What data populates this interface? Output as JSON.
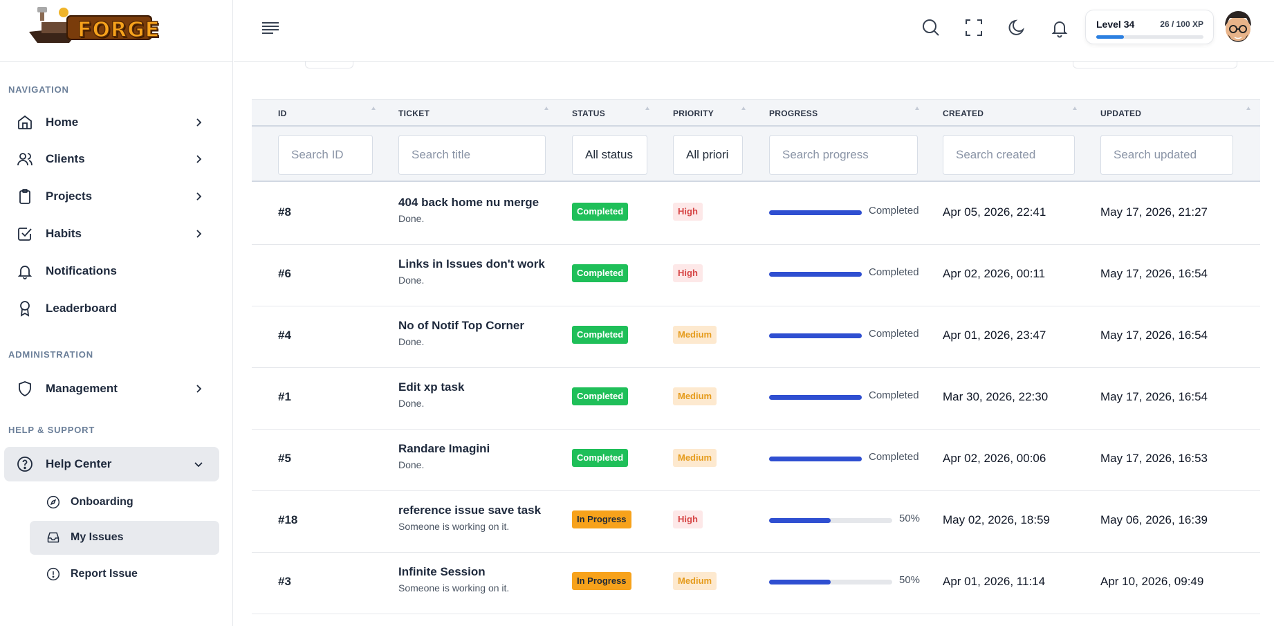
{
  "app": {
    "logo_text": "FORGE"
  },
  "sidebar": {
    "sections": {
      "navigation": "NAVIGATION",
      "administration": "ADMINISTRATION",
      "help": "HELP & SUPPORT"
    },
    "items": [
      {
        "label": "Home",
        "icon": "home-icon"
      },
      {
        "label": "Clients",
        "icon": "users-icon"
      },
      {
        "label": "Projects",
        "icon": "clipboard-icon"
      },
      {
        "label": "Habits",
        "icon": "checkbox-icon"
      },
      {
        "label": "Notifications",
        "icon": "bell-icon"
      },
      {
        "label": "Leaderboard",
        "icon": "award-icon"
      },
      {
        "label": "Management",
        "icon": "shield-icon"
      },
      {
        "label": "Help Center",
        "icon": "help-circle-icon"
      }
    ],
    "subitems": [
      {
        "label": "Onboarding",
        "icon": "compass-icon"
      },
      {
        "label": "My Issues",
        "icon": "inbox-icon"
      },
      {
        "label": "Report Issue",
        "icon": "alert-circle-icon"
      }
    ]
  },
  "header": {
    "level_label": "Level 34",
    "xp_label": "26 / 100 XP",
    "xp_progress": 0.26
  },
  "table": {
    "columns": [
      "ID",
      "TICKET",
      "STATUS",
      "PRIORITY",
      "PROGRESS",
      "CREATED",
      "UPDATED"
    ],
    "filters": {
      "id": "Search ID",
      "title": "Search title",
      "status": "All status",
      "priority": "All priori",
      "progress": "Search progress",
      "created": "Search created",
      "updated": "Search updated"
    },
    "rows": [
      {
        "id": "#8",
        "title": "404 back home nu merge",
        "subtitle": "Done.",
        "status": "Completed",
        "priority": "High",
        "progress": 100,
        "progress_label": "Completed",
        "created": "Apr 05, 2026, 22:41",
        "updated": "May 17, 2026, 21:27"
      },
      {
        "id": "#6",
        "title": "Links in Issues don't work",
        "subtitle": "Done.",
        "status": "Completed",
        "priority": "High",
        "progress": 100,
        "progress_label": "Completed",
        "created": "Apr 02, 2026, 00:11",
        "updated": "May 17, 2026, 16:54"
      },
      {
        "id": "#4",
        "title": "No of Notif Top Corner",
        "subtitle": "Done.",
        "status": "Completed",
        "priority": "Medium",
        "progress": 100,
        "progress_label": "Completed",
        "created": "Apr 01, 2026, 23:47",
        "updated": "May 17, 2026, 16:54"
      },
      {
        "id": "#1",
        "title": "Edit xp task",
        "subtitle": "Done.",
        "status": "Completed",
        "priority": "Medium",
        "progress": 100,
        "progress_label": "Completed",
        "created": "Mar 30, 2026, 22:30",
        "updated": "May 17, 2026, 16:54"
      },
      {
        "id": "#5",
        "title": "Randare Imagini",
        "subtitle": "Done.",
        "status": "Completed",
        "priority": "Medium",
        "progress": 100,
        "progress_label": "Completed",
        "created": "Apr 02, 2026, 00:06",
        "updated": "May 17, 2026, 16:53"
      },
      {
        "id": "#18",
        "title": "reference issue save task",
        "subtitle": "Someone is working on it.",
        "status": "In Progress",
        "priority": "High",
        "progress": 50,
        "progress_label": "50%",
        "created": "May 02, 2026, 18:59",
        "updated": "May 06, 2026, 16:39"
      },
      {
        "id": "#3",
        "title": "Infinite Session",
        "subtitle": "Someone is working on it.",
        "status": "In Progress",
        "priority": "Medium",
        "progress": 50,
        "progress_label": "50%",
        "created": "Apr 01, 2026, 11:14",
        "updated": "Apr 10, 2026, 09:49"
      }
    ]
  }
}
